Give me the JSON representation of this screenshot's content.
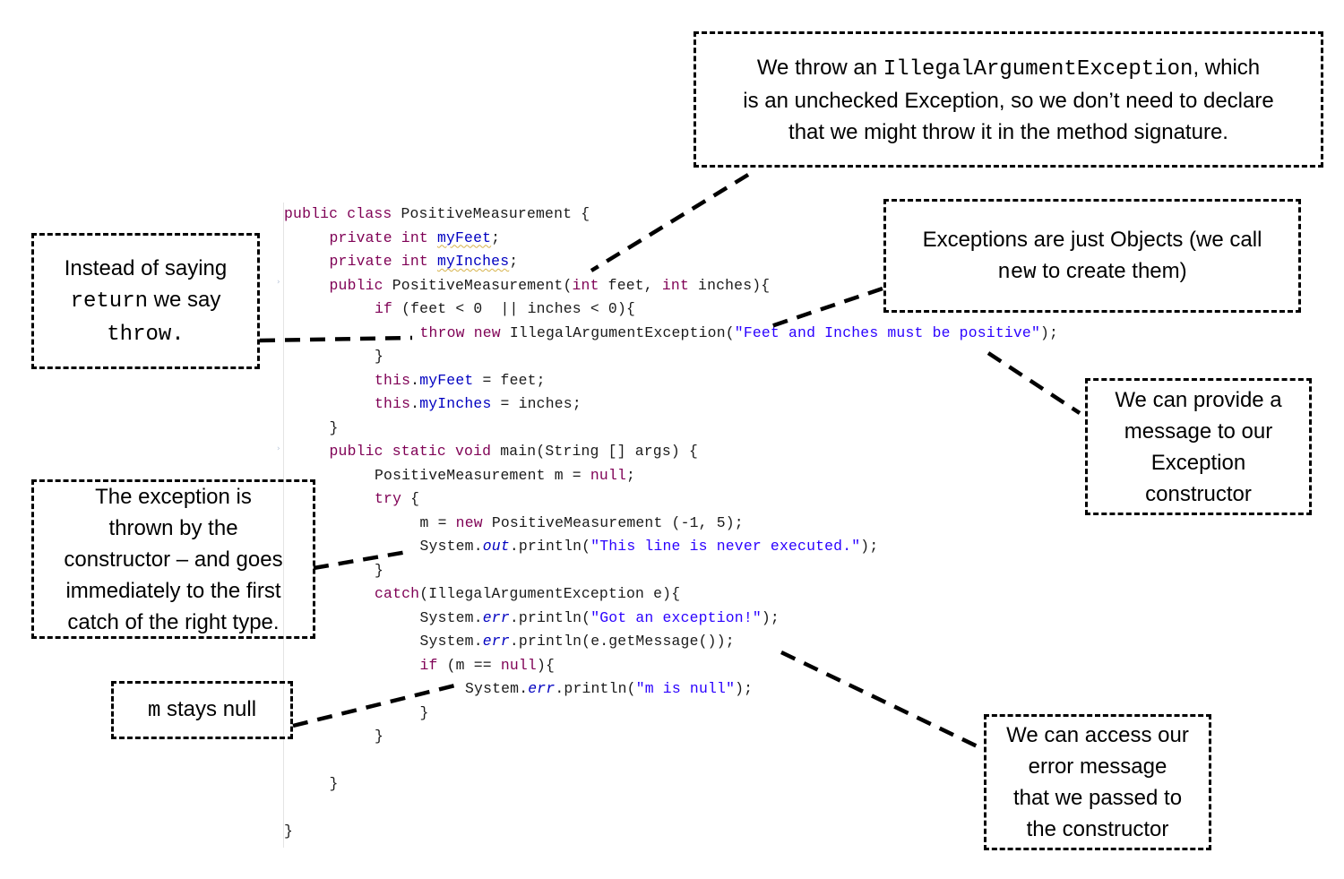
{
  "code": {
    "lines": [
      {
        "indent": 0,
        "parts": [
          {
            "t": "public class ",
            "c": "kw"
          },
          {
            "t": "PositiveMeasurement {"
          }
        ]
      },
      {
        "indent": 1,
        "parts": [
          {
            "t": "private int ",
            "c": "kw"
          },
          {
            "t": "myFeet",
            "c": "fld wavy"
          },
          {
            "t": ";"
          }
        ]
      },
      {
        "indent": 1,
        "parts": [
          {
            "t": "private int ",
            "c": "kw"
          },
          {
            "t": "myInches",
            "c": "fld wavy"
          },
          {
            "t": ";"
          }
        ]
      },
      {
        "indent": 1,
        "parts": [
          {
            "t": "public ",
            "c": "kw"
          },
          {
            "t": "PositiveMeasurement("
          },
          {
            "t": "int ",
            "c": "kw"
          },
          {
            "t": "feet, "
          },
          {
            "t": "int ",
            "c": "kw"
          },
          {
            "t": "inches){"
          }
        ]
      },
      {
        "indent": 2,
        "parts": [
          {
            "t": "if ",
            "c": "kw"
          },
          {
            "t": "(feet < 0  || inches < 0){"
          }
        ]
      },
      {
        "indent": 3,
        "parts": [
          {
            "t": "throw new ",
            "c": "kw"
          },
          {
            "t": "IllegalArgumentException("
          },
          {
            "t": "\"Feet and Inches must be positive\"",
            "c": "str"
          },
          {
            "t": ");"
          }
        ]
      },
      {
        "indent": 2,
        "parts": [
          {
            "t": "}"
          }
        ]
      },
      {
        "indent": 2,
        "parts": [
          {
            "t": "this",
            "c": "kw"
          },
          {
            "t": "."
          },
          {
            "t": "myFeet",
            "c": "fld"
          },
          {
            "t": " = feet;"
          }
        ]
      },
      {
        "indent": 2,
        "parts": [
          {
            "t": "this",
            "c": "kw"
          },
          {
            "t": "."
          },
          {
            "t": "myInches",
            "c": "fld"
          },
          {
            "t": " = inches;"
          }
        ]
      },
      {
        "indent": 1,
        "parts": [
          {
            "t": "}"
          }
        ]
      },
      {
        "indent": 1,
        "parts": [
          {
            "t": "public static void ",
            "c": "kw"
          },
          {
            "t": "main(String [] args) {"
          }
        ]
      },
      {
        "indent": 2,
        "parts": [
          {
            "t": "PositiveMeasurement m = "
          },
          {
            "t": "null",
            "c": "kw"
          },
          {
            "t": ";"
          }
        ]
      },
      {
        "indent": 2,
        "parts": [
          {
            "t": "try ",
            "c": "kw"
          },
          {
            "t": "{"
          }
        ]
      },
      {
        "indent": 3,
        "parts": [
          {
            "t": "m = "
          },
          {
            "t": "new ",
            "c": "kw"
          },
          {
            "t": "PositiveMeasurement (-1, 5);"
          }
        ]
      },
      {
        "indent": 3,
        "parts": [
          {
            "t": "System."
          },
          {
            "t": "out",
            "c": "sfld"
          },
          {
            "t": ".println("
          },
          {
            "t": "\"This line is never executed.\"",
            "c": "str"
          },
          {
            "t": ");"
          }
        ]
      },
      {
        "indent": 2,
        "parts": [
          {
            "t": "}"
          }
        ]
      },
      {
        "indent": 2,
        "parts": [
          {
            "t": "catch",
            "c": "kw"
          },
          {
            "t": "(IllegalArgumentException e){"
          }
        ]
      },
      {
        "indent": 3,
        "parts": [
          {
            "t": "System."
          },
          {
            "t": "err",
            "c": "sfld"
          },
          {
            "t": ".println("
          },
          {
            "t": "\"Got an exception!\"",
            "c": "str"
          },
          {
            "t": ");"
          }
        ]
      },
      {
        "indent": 3,
        "parts": [
          {
            "t": "System."
          },
          {
            "t": "err",
            "c": "sfld"
          },
          {
            "t": ".println(e.getMessage());"
          }
        ]
      },
      {
        "indent": 3,
        "parts": [
          {
            "t": "if ",
            "c": "kw"
          },
          {
            "t": "(m == "
          },
          {
            "t": "null",
            "c": "kw"
          },
          {
            "t": "){"
          }
        ]
      },
      {
        "indent": 4,
        "parts": [
          {
            "t": "System."
          },
          {
            "t": "err",
            "c": "sfld"
          },
          {
            "t": ".println("
          },
          {
            "t": "\"m is null\"",
            "c": "str"
          },
          {
            "t": ");"
          }
        ]
      },
      {
        "indent": 3,
        "parts": [
          {
            "t": "}"
          }
        ]
      },
      {
        "indent": 2,
        "parts": [
          {
            "t": "}"
          }
        ]
      },
      {
        "indent": 0,
        "parts": []
      },
      {
        "indent": 1,
        "parts": [
          {
            "t": "}"
          }
        ]
      },
      {
        "indent": 0,
        "parts": []
      },
      {
        "indent": 0,
        "parts": [
          {
            "t": "}"
          }
        ]
      }
    ]
  },
  "callouts": {
    "unchecked": {
      "line1_a": "We throw an ",
      "line1_code": "IllegalArgumentException",
      "line1_b": ", which",
      "line2": "is an unchecked Exception, so we don’t need to declare",
      "line3": "that we might throw it in the method signature."
    },
    "objects": {
      "line1": "Exceptions are just Objects (we call",
      "line2_code": "new",
      "line2_b": " to create them)"
    },
    "throw_keyword": {
      "line1": "Instead of saying",
      "line2_code": "return",
      "line2_b": " we say",
      "line3_code": "throw."
    },
    "message": {
      "line1": "We can provide a",
      "line2": "message to  our",
      "line3": "Exception",
      "line4": "constructor"
    },
    "catch_flow": {
      "line1": "The exception is",
      "line2": "thrown by the",
      "line3": "constructor – and goes",
      "line4": "immediately to the first",
      "line5": "catch of the right type."
    },
    "stays_null": {
      "code": "m",
      "text": " stays null"
    },
    "get_message": {
      "line1": "We can access our",
      "line2": "error message",
      "line3": "that we passed to",
      "line4": "the constructor"
    }
  },
  "colors": {
    "keyword": "#7f0055",
    "field": "#0000c0",
    "string": "#2a00ff",
    "text": "#1a1a1a",
    "border": "#000000"
  }
}
